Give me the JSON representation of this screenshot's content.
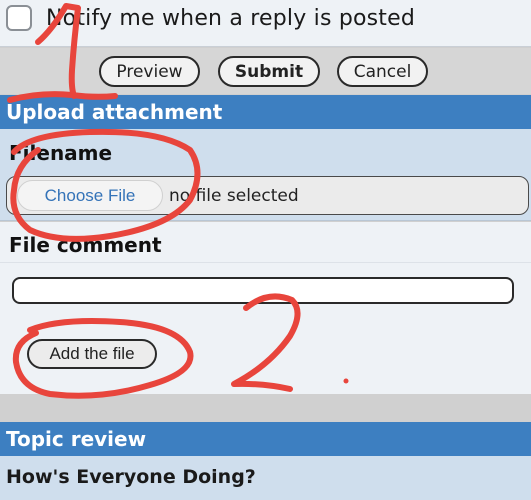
{
  "notify": {
    "label": "Notify me when a reply is posted",
    "checked": false
  },
  "actions": {
    "preview": "Preview",
    "submit": "Submit",
    "cancel": "Cancel"
  },
  "upload": {
    "header": "Upload attachment",
    "filename_label": "Filename",
    "choose_file": "Choose File",
    "no_file": "no file selected",
    "comment_label": "File comment",
    "comment_value": "",
    "add_file": "Add the file"
  },
  "topic": {
    "header": "Topic review",
    "title": "How's Everyone Doing?"
  },
  "annotation_color": "#e8453c",
  "colors": {
    "section_header": "#3d7fc1",
    "panel_blue": "#cfdeed",
    "link_blue": "#3473b8"
  }
}
